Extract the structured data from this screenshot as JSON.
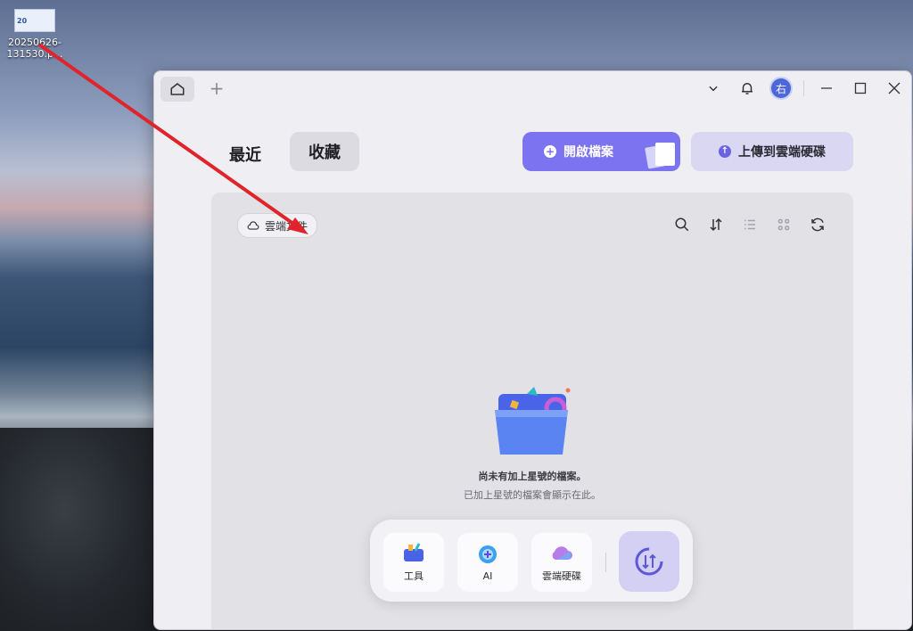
{
  "desktop": {
    "icon_thumb_text": "20",
    "icon_label": "20250626-131530.p..."
  },
  "window": {
    "tabs": {
      "home_icon": "home-icon",
      "add_label": "+"
    },
    "controls": {
      "avatar_text": "右"
    },
    "nav": {
      "recent": "最近",
      "favorites": "收藏"
    },
    "actions": {
      "open_file": "開啟檔案",
      "upload_cloud": "上傳到雲端硬碟"
    },
    "content": {
      "cloud_chip": "雲端文件",
      "empty_title": "尚未有加上星號的檔案。",
      "empty_subtitle": "已加上星號的檔案會顯示在此。"
    },
    "dock": {
      "tools": "工具",
      "ai": "AI",
      "cloud_drive": "雲端硬碟"
    }
  },
  "colors": {
    "accent": "#7b73f0",
    "annotation_arrow": "#e0242a"
  }
}
